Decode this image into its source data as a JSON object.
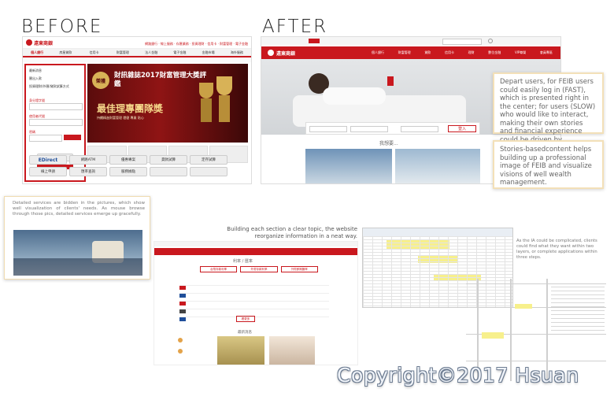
{
  "headings": {
    "before": "BEFORE",
    "after": "AFTER"
  },
  "before_site": {
    "logo_text": "遠東商銀",
    "top_links": "網路銀行 · 線上服務 · 存匯業務 · 投資理財 · 信用卡 · 財富管理 · 電子金融",
    "tabs": [
      "個人銀行",
      "房屋貸款",
      "信用卡",
      "財富管理",
      "法人金融",
      "電子金融",
      "金融市場",
      "海外服務"
    ],
    "login": {
      "items": [
        "最新消息",
        "匯出入款",
        "投資理財/外匯/貸款試算方式"
      ],
      "fields": [
        "身分證字號",
        "使用者代號",
        "密碼"
      ],
      "login_button": "登入"
    },
    "banner": {
      "badge": "榮獲",
      "title": "財訊雜誌2017財富管理大獎評鑑",
      "headline": "最佳理專團隊獎",
      "sub": "持續精進財富管理 穩健 專業 貼心"
    },
    "shortcuts": [
      "EDirect",
      "網路ATM",
      "優惠專案",
      "貸款試算",
      "定存試算",
      "線上申請",
      "匯率查詢",
      "服務據點"
    ]
  },
  "after_site": {
    "logo_text": "遠東商銀",
    "nav": [
      "個人銀行",
      "財富管理",
      "貸款",
      "信用卡",
      "理財",
      "數位金融",
      "VIP尊榮",
      "會員專區"
    ],
    "login_button": "登入",
    "section_title": "我想要..."
  },
  "notes": {
    "depart": "Depart users, for FEIB users could easily log in (FAST), which is presented right in the center; for users (SLOW) who would like to interact, making their own stories and financial experience could be driven by situational photos.",
    "stories": "Stories-basedcontent helps building up a professional image of FEIB and visualize visions of well wealth management.",
    "hidden": "Detailed services are bidden in the pictures, which show well visualization of clients' needs. As mouse browse through those pics, detailed services emerge up gracefully.",
    "clear_topic": "Building each section a clear topic, the website reorganize information in a neat way.",
    "ia": "As the IA could be complicated, clients could find what they want within two layers, or complete applications within three steps."
  },
  "rates_page": {
    "title": "利率 / 匯率",
    "tabs": [
      "台幣存款利率",
      "外幣存款利率",
      "外幣即期匯率"
    ],
    "more_button": "看更多",
    "news_title": "最新消息"
  },
  "copyright": "Copyright©2017 Hsuan"
}
